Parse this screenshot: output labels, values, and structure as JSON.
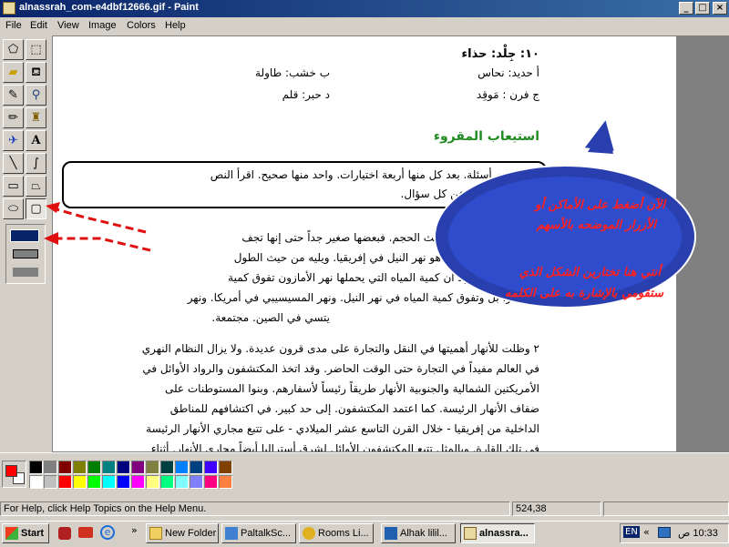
{
  "window": {
    "title": "alnassrah_com-e4dbf12666.gif - Paint"
  },
  "menu": [
    "File",
    "Edit",
    "View",
    "Image",
    "Colors",
    "Help"
  ],
  "tools": [
    "free-select",
    "select",
    "eraser",
    "fill",
    "picker",
    "magnifier",
    "pencil",
    "brush",
    "airbrush",
    "text",
    "line",
    "curve",
    "rectangle",
    "polygon",
    "ellipse",
    "rounded-rectangle"
  ],
  "document": {
    "q10": "١٠: جِلْد: حذاء",
    "opt_a": "أ     حديد: نحاس",
    "opt_b": "ب    خشب: طاولة",
    "opt_c": "ج    فرن : مَوقِد",
    "opt_d": "د    حبر: قلم",
    "section_title": "استيعاب المقروء",
    "instructions_1": "نصّ. تتبعه أسئلة. بعد كل منها أربعة اختيارات. واحد منها صحيح. اقرأ النص",
    "instructions_2": "الإجابة الصحيحة عن كل سؤال.",
    "p1_1": "بينها اختلافاً كبيراً من حيث الحجم. فبعضها صغير جداً حتى إنها تجف",
    "p1_2": "وأطول نهر في العالم هو نهر النيل في إفريقيا. ويليه من حيث الطول",
    "p1_3": "أمريكا الجنوبية. إلا أن كمية المياه التي يحملها نهر الأمازون تفوق كمية",
    "p1_4": "نهر آخر. بل وتفوق كمية المياه في نهر النيل. ونهر المسيسيبي في أمريكا. ونهر",
    "p1_5": "يتسي في الصين. مجتمعة.",
    "p2_1": "٢  وظلت للأنهار أهميتها في النقل والتجارة على مدى قرون عديدة. ولا يزال النظام النهري",
    "p2_2": "في العالم مفيداً في التجارة حتى الوقت الحاضر. وقد اتخذ المكتشفون والرواد الأوائل في",
    "p2_3": "الأمريكتين الشمالية والجنوبية الأنهار طريقاً رئيساً لأسفارهم. وبنوا المستوطنات على",
    "p2_4": "ضفاف الأنهار الرئيسة. كما اعتمد المكتشفون. إلى حد كبير. في اكتشافهم للمناطق",
    "p2_5": "الداخلية من إفريقيا - خلال القرن التاسع عشر الميلادي - على تتبع مجاري الأنهار الرئيسة",
    "p2_6": "في تلك القارة. وبالمثل تتبع المكتشفون الأوائل لشرق أستراليا أيضاً مجاري الأنهار. أثناء"
  },
  "callout": {
    "line1": "الآن أضغط على الأماكن أو",
    "line2": "الأزرار الموضحه بالأسهم",
    "line3": "أنتي هنا تختارين الشكل الذي",
    "line4": "ستقومي بالإشارة به على الكلمه"
  },
  "palette": {
    "foreground": "#ff0000",
    "background": "#ffffff",
    "colors_row1": [
      "#000000",
      "#808080",
      "#800000",
      "#808000",
      "#008000",
      "#008080",
      "#000080",
      "#800080",
      "#808040",
      "#004040",
      "#0080ff",
      "#004080",
      "#4000ff",
      "#804000"
    ],
    "colors_row2": [
      "#ffffff",
      "#c0c0c0",
      "#ff0000",
      "#ffff00",
      "#00ff00",
      "#00ffff",
      "#0000ff",
      "#ff00ff",
      "#ffff80",
      "#00ff80",
      "#80ffff",
      "#8080ff",
      "#ff0080",
      "#ff8040"
    ]
  },
  "status": {
    "help": "For Help, click Help Topics on the Help Menu.",
    "coords": "524,38"
  },
  "taskbar": {
    "start": "Start",
    "buttons": [
      "New Folder",
      "PaltalkSc...",
      "Rooms Li...",
      "Alhak lilil...",
      "alnassra..."
    ],
    "lang": "EN",
    "time": "10:33 ص"
  },
  "colors": {
    "accent_title": "#0a246a",
    "callout_fill": "#2a3fae",
    "callout_text": "#ff2020",
    "section_green": "#228b22"
  }
}
